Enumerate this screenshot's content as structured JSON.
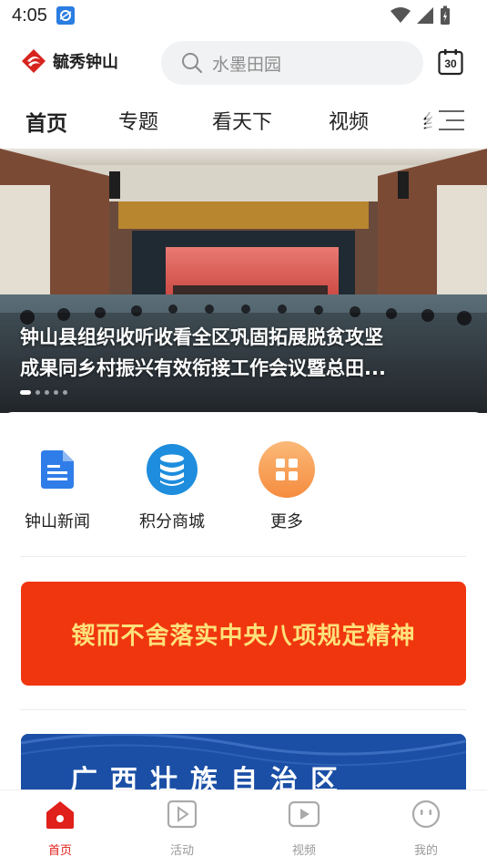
{
  "status": {
    "time": "4:05"
  },
  "header": {
    "logo_text": "毓秀钟山",
    "search_placeholder": "水墨田园",
    "calendar_day": "30"
  },
  "tabs": [
    {
      "label": "首页",
      "active": true
    },
    {
      "label": "专题"
    },
    {
      "label": "看天下"
    },
    {
      "label": "视频"
    },
    {
      "label": "纟"
    }
  ],
  "banner": {
    "caption_line1": "钟山县组织收听收看全区巩固拓展脱贫攻坚",
    "caption_line2": "成果同乡村振兴有效衔接工作会议暨总田..."
  },
  "quick_links": [
    {
      "label": "钟山新闻",
      "icon": "document-icon",
      "color": "#2f7de8"
    },
    {
      "label": "积分商城",
      "icon": "database-icon",
      "color": "#1e8ddd"
    },
    {
      "label": "更多",
      "icon": "grid-icon",
      "color": "#f7a25a"
    }
  ],
  "promo_banner": {
    "text": "锲而不舍落实中央八项规定精神"
  },
  "second_banner": {
    "text": "广西壮族自治区"
  },
  "bottom_nav": [
    {
      "label": "首页",
      "icon": "home-icon",
      "active": true
    },
    {
      "label": "活动",
      "icon": "activity-icon"
    },
    {
      "label": "视频",
      "icon": "video-icon"
    },
    {
      "label": "我的",
      "icon": "profile-icon"
    }
  ],
  "colors": {
    "accent": "#e0201b",
    "promo_bg": "#f0360e",
    "promo_text": "#fde17a"
  }
}
